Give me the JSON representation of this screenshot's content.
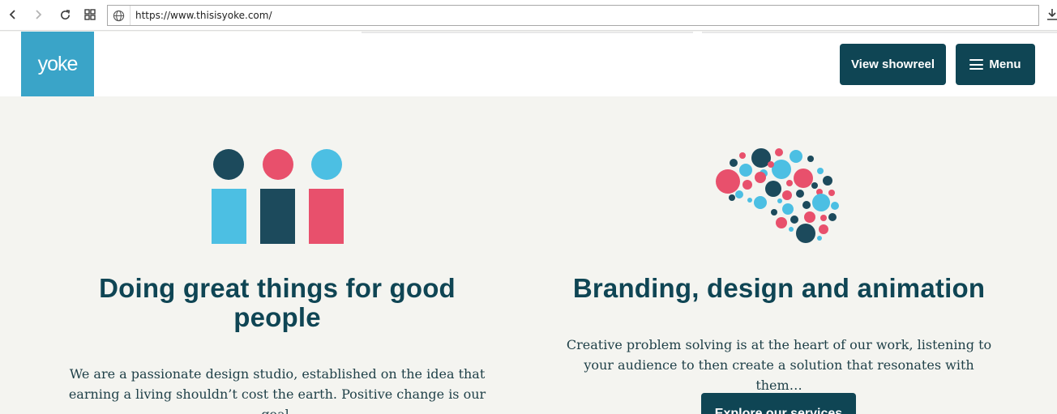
{
  "browser": {
    "url": "https://www.thisisyoke.com/",
    "back_icon": "arrow-left-icon",
    "forward_icon": "arrow-right-icon",
    "reload_icon": "reload-icon",
    "tabs_icon": "grid-icon",
    "download_icon": "download-icon"
  },
  "header": {
    "logo_text": "yoke",
    "showreel_label": "View showreel",
    "menu_label": "Menu"
  },
  "left": {
    "title": "Doing great things for good people",
    "paragraph": "We are a passionate design studio, established on the idea that earning a living shouldn’t cost the earth. Positive change is our goal."
  },
  "right": {
    "title": "Branding, design and animation",
    "paragraph": "Creative problem solving is at the heart of our work, listening to your audience to then create a solution that resonates with them…",
    "button_label": "Explore our services"
  },
  "colors": {
    "brand_dark": "#0f4554",
    "brand_blue": "#3aa4c8",
    "pink": "#e8506c",
    "light_blue": "#4cbfe3",
    "navy": "#1c4a5c",
    "background": "#f4f4f0"
  }
}
